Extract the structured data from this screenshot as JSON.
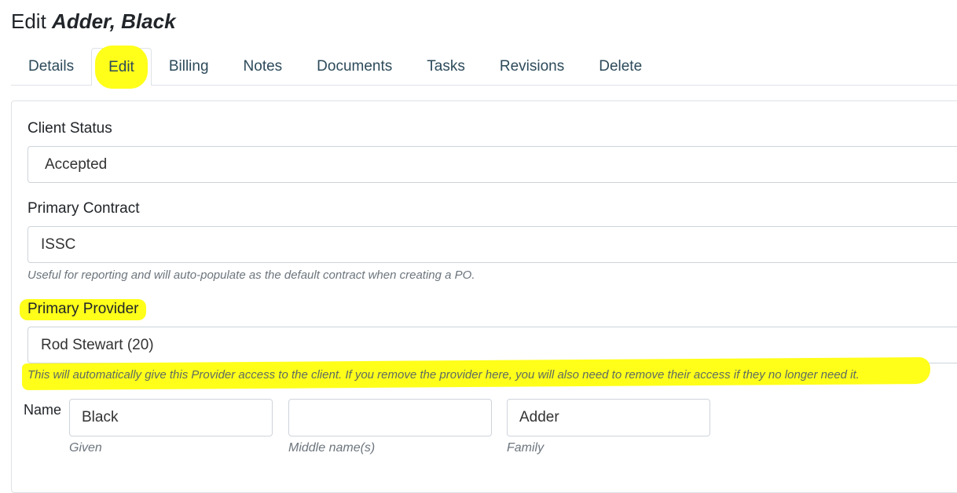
{
  "page": {
    "title_prefix": "Edit",
    "title_name": "Adder, Black"
  },
  "tabs": [
    {
      "label": "Details"
    },
    {
      "label": "Edit",
      "active": true
    },
    {
      "label": "Billing"
    },
    {
      "label": "Notes"
    },
    {
      "label": "Documents"
    },
    {
      "label": "Tasks"
    },
    {
      "label": "Revisions"
    },
    {
      "label": "Delete"
    }
  ],
  "form": {
    "client_status": {
      "label": "Client Status",
      "value": "Accepted"
    },
    "primary_contract": {
      "label": "Primary Contract",
      "value": "ISSC",
      "help": "Useful for reporting and will auto-populate as the default contract when creating a PO."
    },
    "primary_provider": {
      "label": "Primary Provider",
      "value": "Rod Stewart (20)",
      "help": "This will automatically give this Provider access to the client. If you remove the provider here, you will also need to remove their access if they no longer need it."
    },
    "name": {
      "label": "Name",
      "given": {
        "value": "Black",
        "sub": "Given"
      },
      "middle": {
        "value": "",
        "sub": "Middle name(s)"
      },
      "family": {
        "value": "Adder",
        "sub": "Family"
      }
    }
  },
  "colors": {
    "highlight": "#ffff1a",
    "tab_text": "#2c4a5a",
    "border": "#dee2e6",
    "help_text": "#6c757d"
  }
}
